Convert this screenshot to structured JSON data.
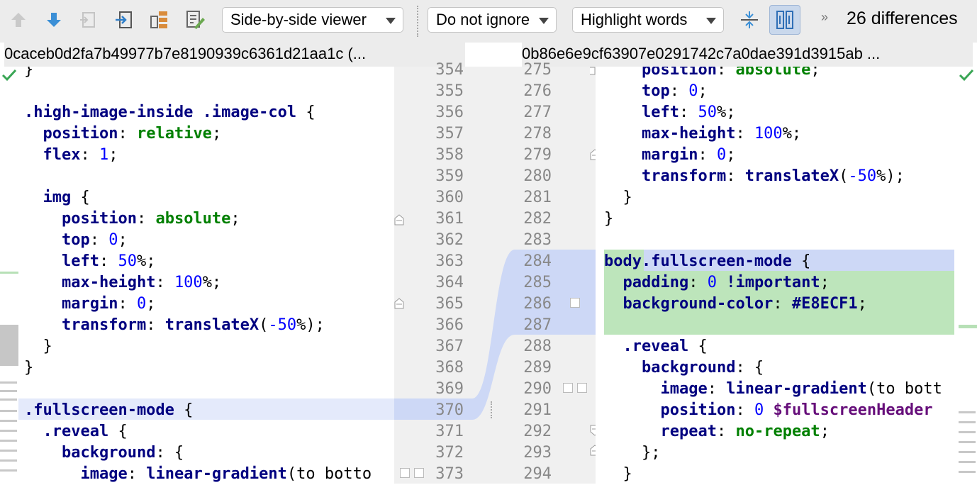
{
  "toolbar": {
    "icons": [
      "previous-difference-icon",
      "next-difference-icon",
      "compare-previous-file-icon",
      "compare-next-file-icon",
      "navigate-icon",
      "edit-source-icon"
    ],
    "viewer_mode": "Side-by-side viewer",
    "ignore_mode": "Do not ignore",
    "highlight_mode": "Highlight words",
    "diff_count": "26 differences",
    "overflow": "»"
  },
  "left_header": "0caceb0d2fa7b49977b7e8190939c6361d21aa1c (...",
  "right_header": "0b86e6e9cf63907e0291742c7a0dae391d3915ab ...",
  "colors": {
    "added_bg": "#bde5bb",
    "modified_bg": "#cdd8f6",
    "changed_line_bg": "#e4eafb",
    "gutter_bg": "#f0f0f0",
    "keyword": "#000080",
    "value": "#008000",
    "number": "#0000ff",
    "variable": "#660e7a"
  },
  "left_line_numbers": [
    "354",
    "355",
    "356",
    "357",
    "358",
    "359",
    "360",
    "361",
    "362",
    "363",
    "364",
    "365",
    "366",
    "367",
    "368",
    "369",
    "370",
    "371",
    "372",
    "373"
  ],
  "right_line_numbers": [
    "275",
    "276",
    "277",
    "278",
    "279",
    "280",
    "281",
    "282",
    "283",
    "284",
    "285",
    "286",
    "287",
    "288",
    "289",
    "290",
    "291",
    "292",
    "293",
    "294"
  ],
  "left_code": [
    "}",
    "",
    ".high-image-inside .image-col {",
    "  position: relative;",
    "  flex: 1;",
    "",
    "  img {",
    "    position: absolute;",
    "    top: 0;",
    "    left: 50%;",
    "    max-height: 100%;",
    "    margin: 0;",
    "    transform: translateX(-50%);",
    "  }",
    "}",
    "",
    ".fullscreen-mode {",
    "  .reveal {",
    "    background: {",
    "      image: linear-gradient(to botto"
  ],
  "right_code": [
    "    position: absolute;",
    "    top: 0;",
    "    left: 50%;",
    "    max-height: 100%;",
    "    margin: 0;",
    "    transform: translateX(-50%);",
    "  }",
    "}",
    "",
    "body.fullscreen-mode {",
    "  padding: 0 !important;",
    "  background-color: #E8ECF1;",
    "",
    "  .reveal {",
    "    background: {",
    "      image: linear-gradient(to bott",
    "      position: 0 $fullscreenHeader",
    "      repeat: no-repeat;",
    "    };",
    "  }"
  ]
}
